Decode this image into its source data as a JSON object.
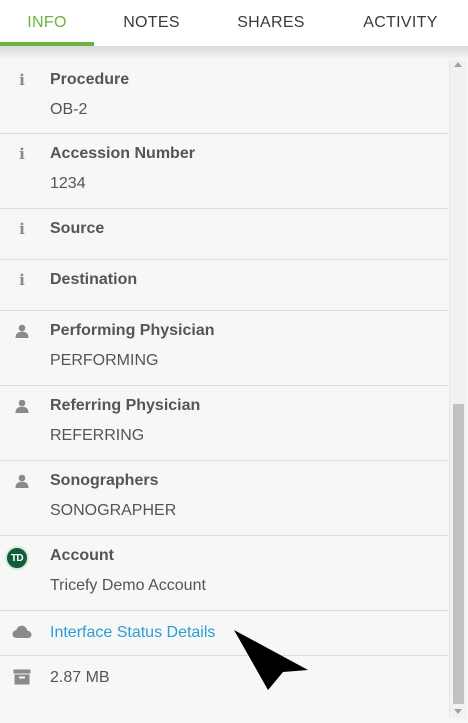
{
  "tabs": [
    {
      "label": "INFO",
      "active": true
    },
    {
      "label": "NOTES",
      "active": false
    },
    {
      "label": "SHARES",
      "active": false
    },
    {
      "label": "ACTIVITY",
      "active": false
    }
  ],
  "colors": {
    "accent": "#6cb33f",
    "link": "#2a9fd6",
    "avatar_bg": "#0f5e3a"
  },
  "fields": {
    "procedure": {
      "label": "Procedure",
      "value": "OB-2",
      "icon": "info-icon"
    },
    "accession": {
      "label": "Accession Number",
      "value": "1234",
      "icon": "info-icon"
    },
    "source": {
      "label": "Source",
      "icon": "info-icon"
    },
    "destination": {
      "label": "Destination",
      "icon": "info-icon"
    },
    "performing": {
      "label": "Performing Physician",
      "value": "PERFORMING",
      "icon": "person-icon"
    },
    "referring": {
      "label": "Referring Physician",
      "value": "REFERRING",
      "icon": "person-icon"
    },
    "sonographers": {
      "label": "Sonographers",
      "value": "SONOGRAPHER",
      "icon": "person-icon"
    },
    "account": {
      "label": "Account",
      "value": "Tricefy Demo Account",
      "avatar_initials": "TD"
    },
    "interface": {
      "link_label": "Interface Status Details",
      "icon": "cloud-icon"
    },
    "size": {
      "value": "2.87 MB",
      "icon": "archive-icon"
    }
  }
}
